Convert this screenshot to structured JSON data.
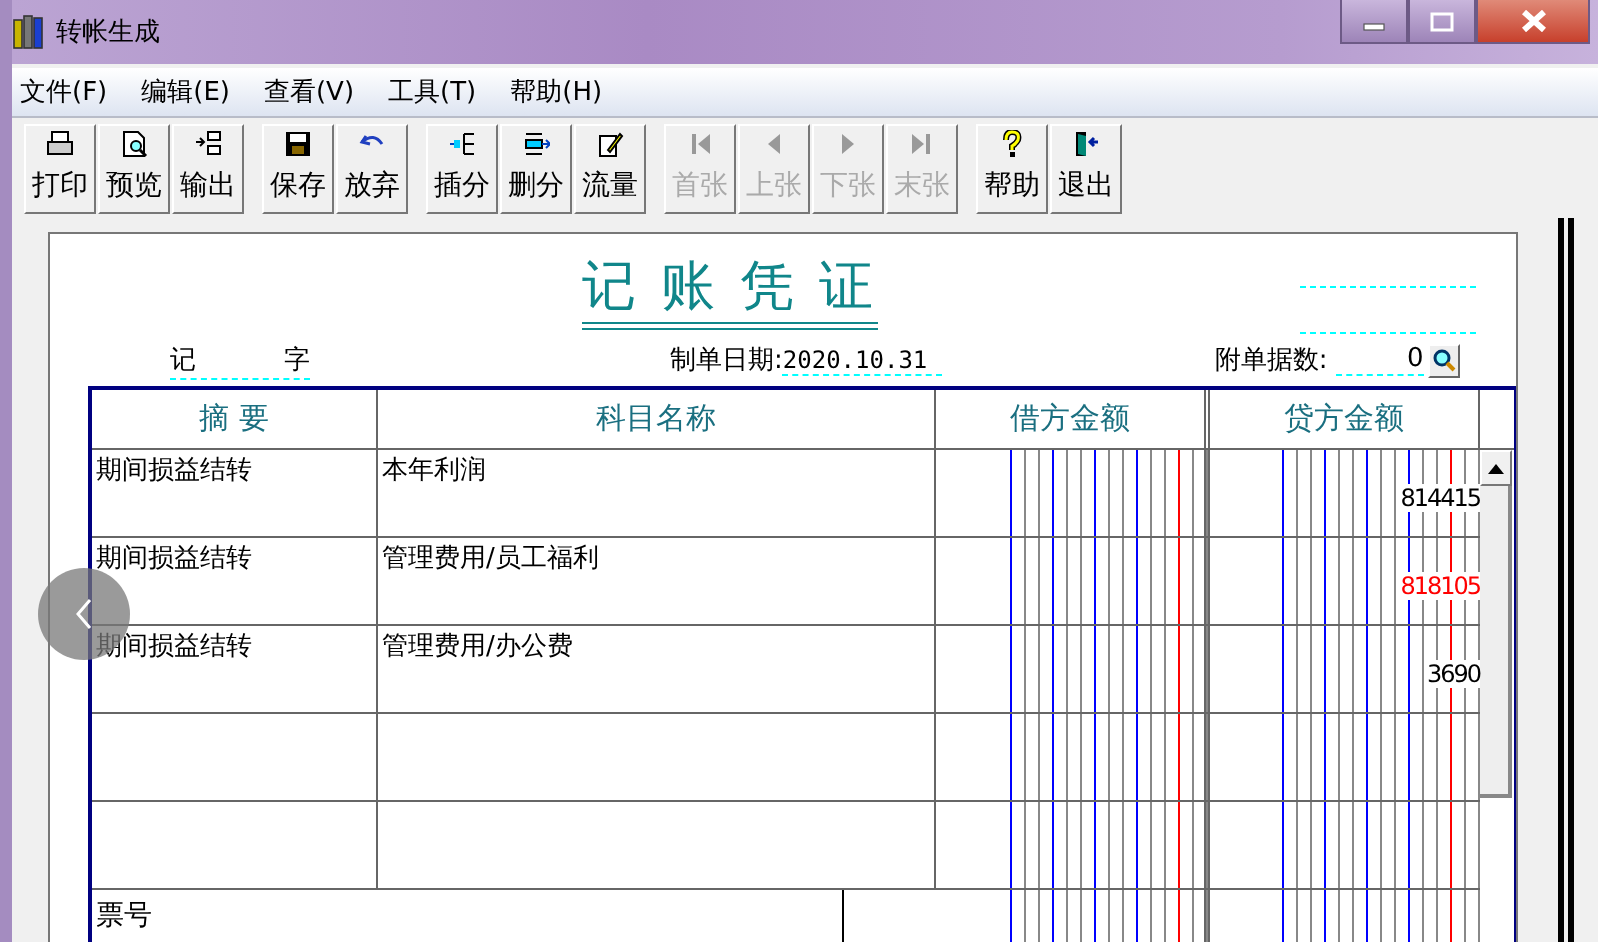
{
  "window": {
    "title": "转帐生成"
  },
  "menu": [
    {
      "label": "文件(F)"
    },
    {
      "label": "编辑(E)"
    },
    {
      "label": "查看(V)"
    },
    {
      "label": "工具(T)"
    },
    {
      "label": "帮助(H)"
    }
  ],
  "toolbar": [
    [
      {
        "label": "打印",
        "kind": "printer",
        "disabled": false
      },
      {
        "label": "预览",
        "kind": "preview",
        "disabled": false
      },
      {
        "label": "输出",
        "kind": "export",
        "disabled": false
      }
    ],
    [
      {
        "label": "保存",
        "kind": "save",
        "disabled": false
      },
      {
        "label": "放弃",
        "kind": "undo",
        "disabled": false
      }
    ],
    [
      {
        "label": "插分",
        "kind": "insert",
        "disabled": false
      },
      {
        "label": "删分",
        "kind": "delete",
        "disabled": false
      },
      {
        "label": "流量",
        "kind": "note",
        "disabled": false
      }
    ],
    [
      {
        "label": "首张",
        "kind": "first",
        "disabled": true
      },
      {
        "label": "上张",
        "kind": "prev",
        "disabled": true
      },
      {
        "label": "下张",
        "kind": "next",
        "disabled": true
      },
      {
        "label": "末张",
        "kind": "last",
        "disabled": true
      }
    ],
    [
      {
        "label": "帮助",
        "kind": "help",
        "disabled": false
      },
      {
        "label": "退出",
        "kind": "exit",
        "disabled": false
      }
    ]
  ],
  "voucher": {
    "title": "记 账 凭 证",
    "type_label": "记",
    "type_suffix": "字",
    "date_label": "制单日期:",
    "date": "2020.10.31",
    "attach_label": "附单据数:",
    "attach_count": "0",
    "columns": [
      "摘 要",
      "科目名称",
      "借方金额",
      "贷方金额"
    ],
    "rows": [
      {
        "summary": "期间损益结转",
        "account": "本年利润",
        "credit": "814415",
        "negative": false
      },
      {
        "summary": "期间损益结转",
        "account": "管理费用/员工福利",
        "credit": "818105",
        "negative": true
      },
      {
        "summary": "期间损益结转",
        "account": "管理费用/办公费",
        "credit": "3690",
        "negative": false
      }
    ],
    "footer": {
      "ticket_label": "票号"
    }
  }
}
